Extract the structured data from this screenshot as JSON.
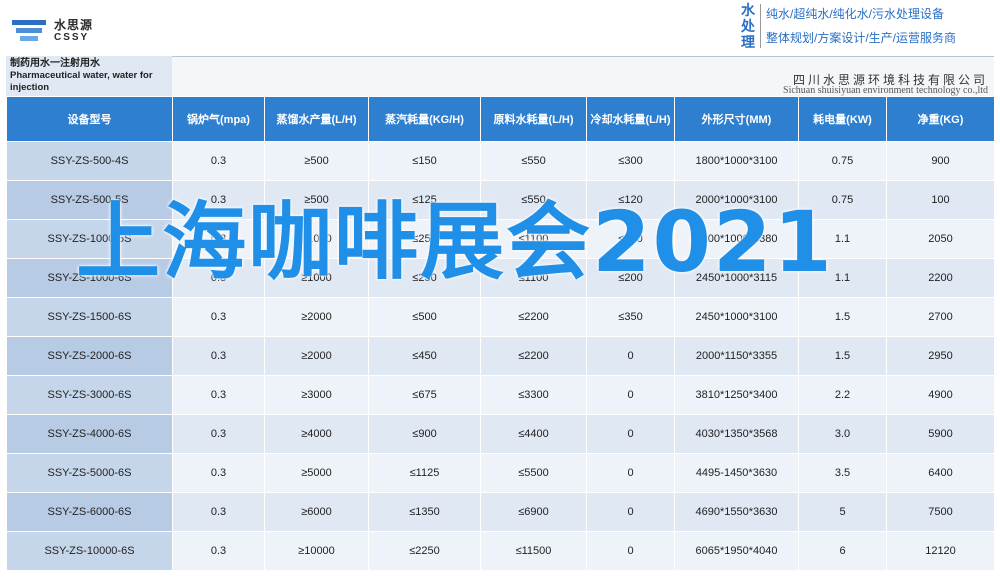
{
  "logo": {
    "cn": "水思源",
    "en": "CSSY"
  },
  "vertical_tag": "水处理",
  "services": [
    "纯水/超纯水/纯化水/污水处理设备",
    "整体规划/方案设计/生产/运营服务商"
  ],
  "doc_title": {
    "cn": "制药用水一注射用水",
    "en": "Pharmaceutical water, water for injection"
  },
  "company": {
    "cn": "四川水思源环境科技有限公司",
    "en": "Sichuan shuisiyuan environment technology co.,ltd"
  },
  "table": {
    "headers": [
      "设备型号",
      "锅炉气(mpa)",
      "蒸馏水产量(L/H)",
      "蒸汽耗量(KG/H)",
      "原料水耗量(L/H)",
      "冷却水耗量(L/H)",
      "外形尺寸(MM)",
      "耗电量(KW)",
      "净重(KG)"
    ],
    "rows": [
      [
        "SSY-ZS-500-4S",
        "0.3",
        "≥500",
        "≤150",
        "≤550",
        "≤300",
        "1800*1000*3100",
        "0.75",
        "900"
      ],
      [
        "SSY-ZS-500-5S",
        "0.3",
        "≥500",
        "≤125",
        "≤550",
        "≤120",
        "2000*1000*3100",
        "0.75",
        "100"
      ],
      [
        "SSY-ZS-1000-5S",
        "0.3",
        "≥1000",
        "≤250",
        "≤1100",
        "≤240",
        "2200*1000*3380",
        "1.1",
        "2050"
      ],
      [
        "SSY-ZS-1000-6S",
        "0.3",
        "≥1000",
        "≤250",
        "≤1100",
        "≤200",
        "2450*1000*3115",
        "1.1",
        "2200"
      ],
      [
        "SSY-ZS-1500-6S",
        "0.3",
        "≥2000",
        "≤500",
        "≤2200",
        "≤350",
        "2450*1000*3100",
        "1.5",
        "2700"
      ],
      [
        "SSY-ZS-2000-6S",
        "0.3",
        "≥2000",
        "≤450",
        "≤2200",
        "0",
        "2000*1150*3355",
        "1.5",
        "2950"
      ],
      [
        "SSY-ZS-3000-6S",
        "0.3",
        "≥3000",
        "≤675",
        "≤3300",
        "0",
        "3810*1250*3400",
        "2.2",
        "4900"
      ],
      [
        "SSY-ZS-4000-6S",
        "0.3",
        "≥4000",
        "≤900",
        "≤4400",
        "0",
        "4030*1350*3568",
        "3.0",
        "5900"
      ],
      [
        "SSY-ZS-5000-6S",
        "0.3",
        "≥5000",
        "≤1125",
        "≤5500",
        "0",
        "4495-1450*3630",
        "3.5",
        "6400"
      ],
      [
        "SSY-ZS-6000-6S",
        "0.3",
        "≥6000",
        "≤1350",
        "≤6900",
        "0",
        "4690*1550*3630",
        "5",
        "7500"
      ],
      [
        "SSY-ZS-10000-6S",
        "0.3",
        "≥10000",
        "≤2250",
        "≤11500",
        "0",
        "6065*1950*4040",
        "6",
        "12120"
      ]
    ]
  },
  "overlay_title": "上海咖啡展会2021",
  "colors": {
    "header_bg": "#2e7fcf",
    "overlay": "#1f8fe8",
    "accent": "#2a6fc4"
  }
}
